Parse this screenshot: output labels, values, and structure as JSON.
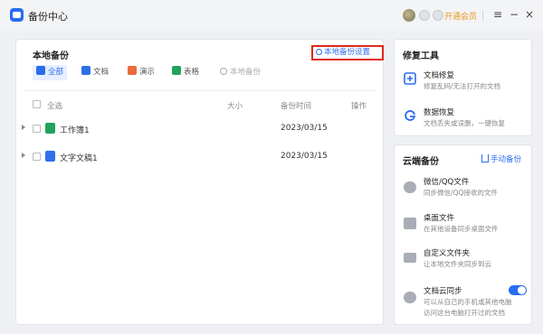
{
  "app": {
    "title": "备份中心",
    "vip_link": "开通会员"
  },
  "local": {
    "section_title": "本地备份",
    "settings_label": "本地备份设置",
    "filters": [
      "全部",
      "文档",
      "演示",
      "表格"
    ],
    "search_placeholder": "本地备份",
    "columns": {
      "select_all": "全选",
      "size": "大小",
      "time": "备份时间",
      "action": "操作"
    },
    "rows": [
      {
        "name": "工作簿1",
        "time": "2023/03/15",
        "type": "sheet"
      },
      {
        "name": "文字文稿1",
        "time": "2023/03/15",
        "type": "doc"
      }
    ]
  },
  "repair": {
    "section_title": "修复工具",
    "items": [
      {
        "title": "文档修复",
        "desc": "修复乱码/无法打开的文档"
      },
      {
        "title": "数据恢复",
        "desc": "文档丢失或误删，一键恢复"
      }
    ]
  },
  "cloud": {
    "section_title": "云端备份",
    "manual_backup": "手动备份",
    "items": [
      {
        "title": "微信/QQ文件",
        "desc": "同步微信/QQ接收的文件"
      },
      {
        "title": "桌面文件",
        "desc": "在其他设备同步桌面文件"
      },
      {
        "title": "自定义文件夹",
        "desc": "让本地文件夹同步到云"
      },
      {
        "title": "文档云同步",
        "desc": "可以从自己的手机或其他电脑",
        "desc2": "访问这台电脑打开过的文档",
        "toggle_on": true
      }
    ]
  },
  "colors": {
    "accent": "#2a6cf0",
    "vip": "#e39b1a",
    "highlight": "#e0281c"
  }
}
